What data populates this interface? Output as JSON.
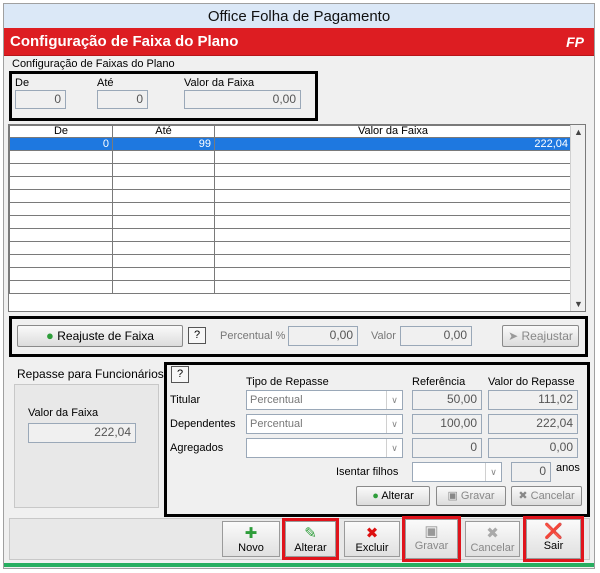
{
  "window": {
    "title": "Office Folha de Pagamento"
  },
  "header": {
    "title": "Configuração de Faixa do Plano",
    "logo": "FP"
  },
  "config": {
    "section_label": "Configuração de Faixas do Plano",
    "de_label": "De",
    "de_value": "0",
    "ate_label": "Até",
    "ate_value": "0",
    "valor_label": "Valor da Faixa",
    "valor_value": "0,00"
  },
  "grid": {
    "columns": [
      "De",
      "Até",
      "Valor da Faixa"
    ],
    "rows": [
      {
        "de": "0",
        "ate": "99",
        "valor": "222,04"
      },
      {
        "de": "",
        "ate": "",
        "valor": ""
      },
      {
        "de": "",
        "ate": "",
        "valor": ""
      },
      {
        "de": "",
        "ate": "",
        "valor": ""
      },
      {
        "de": "",
        "ate": "",
        "valor": ""
      },
      {
        "de": "",
        "ate": "",
        "valor": ""
      },
      {
        "de": "",
        "ate": "",
        "valor": ""
      },
      {
        "de": "",
        "ate": "",
        "valor": ""
      },
      {
        "de": "",
        "ate": "",
        "valor": ""
      },
      {
        "de": "",
        "ate": "",
        "valor": ""
      },
      {
        "de": "",
        "ate": "",
        "valor": ""
      },
      {
        "de": "",
        "ate": "",
        "valor": ""
      }
    ]
  },
  "reajuste": {
    "button_label": "Reajuste de Faixa",
    "help": "?",
    "percentual_label": "Percentual %",
    "percentual_value": "0,00",
    "valor_label": "Valor",
    "valor_value": "0,00",
    "reajustar_label": "Reajustar"
  },
  "repasse": {
    "title": "Repasse para Funcionários",
    "valor_label": "Valor da Faixa",
    "valor_value": "222,04",
    "help": "?",
    "col_tipo": "Tipo de Repasse",
    "col_ref": "Referência",
    "col_valor": "Valor do Repasse",
    "titular": {
      "label": "Titular",
      "tipo": "Percentual",
      "ref": "50,00",
      "valor": "111,02"
    },
    "dependentes": {
      "label": "Dependentes",
      "tipo": "Percentual",
      "ref": "100,00",
      "valor": "222,04"
    },
    "agregados": {
      "label": "Agregados",
      "tipo": "",
      "ref": "0",
      "valor": "0,00"
    },
    "isentar_label": "Isentar filhos",
    "isentar_value": "0",
    "anos_label": "anos",
    "alterar_label": "Alterar",
    "gravar_label": "Gravar",
    "cancelar_label": "Cancelar"
  },
  "actions": {
    "novo": "Novo",
    "alterar": "Alterar",
    "excluir": "Excluir",
    "gravar": "Gravar",
    "cancelar": "Cancelar",
    "sair": "Sair"
  },
  "colors": {
    "header_red": "#dd1d22",
    "selection_blue": "#1e78e0",
    "highlight_red": "#e0141c"
  }
}
